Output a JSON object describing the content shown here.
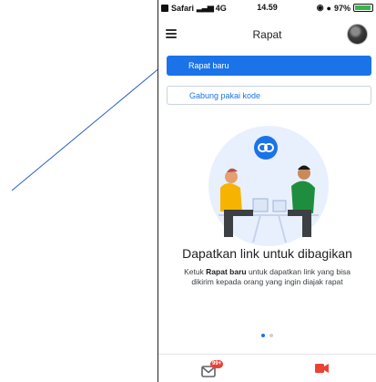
{
  "status_bar": {
    "carrier": "Safari",
    "network": "4G",
    "time": "14.59",
    "battery": "97%",
    "battery_level": 0.97
  },
  "app_bar": {
    "title": "Rapat",
    "menu_icon": "hamburger-menu-icon",
    "avatar_icon": "user-avatar"
  },
  "actions": {
    "new_meeting_label": "Rapat baru",
    "join_with_code_label": "Gabung pakai kode"
  },
  "onboarding": {
    "headline": "Dapatkan link untuk dibagikan",
    "body_prefix": "Ketuk ",
    "body_bold": "Rapat baru",
    "body_suffix": " untuk dapatkan link yang bisa dikirim kepada orang yang ingin diajak rapat",
    "illustration_icon": "link-icon"
  },
  "pager": {
    "pages": 2,
    "active_index": 0
  },
  "bottom_nav": {
    "mail_icon": "mail-icon",
    "mail_badge": "99+",
    "video_icon": "video-camera-icon"
  },
  "colors": {
    "accent": "#1a73e8",
    "badge": "#ea4335",
    "battery": "#39b54a"
  }
}
